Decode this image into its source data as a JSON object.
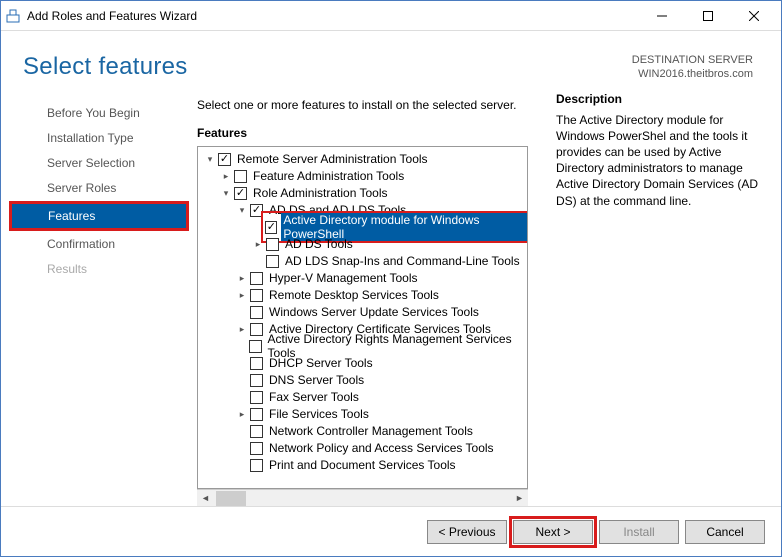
{
  "window": {
    "title": "Add Roles and Features Wizard"
  },
  "header": {
    "title": "Select features",
    "dest_label": "DESTINATION SERVER",
    "dest_server": "WIN2016.theitbros.com"
  },
  "nav": {
    "items": [
      {
        "label": "Before You Begin"
      },
      {
        "label": "Installation Type"
      },
      {
        "label": "Server Selection"
      },
      {
        "label": "Server Roles"
      },
      {
        "label": "Features",
        "active": true
      },
      {
        "label": "Confirmation"
      },
      {
        "label": "Results",
        "disabled": true
      }
    ]
  },
  "content": {
    "instruction": "Select one or more features to install on the selected server.",
    "features_label": "Features",
    "description_label": "Description",
    "description_text": "The Active Directory module for Windows PowerShel and the tools it provides can be used by Active Directory administrators to manage Active Directory Domain Services (AD DS) at the command line."
  },
  "tree": [
    {
      "d": 0,
      "exp": "down",
      "checked": true,
      "label": "Remote Server Administration Tools"
    },
    {
      "d": 1,
      "exp": "right",
      "checked": false,
      "label": "Feature Administration Tools"
    },
    {
      "d": 1,
      "exp": "down",
      "checked": true,
      "label": "Role Administration Tools"
    },
    {
      "d": 2,
      "exp": "down",
      "checked": true,
      "label": "AD DS and AD LDS Tools"
    },
    {
      "d": 3,
      "exp": "",
      "checked": true,
      "label": "Active Directory module for Windows PowerShell",
      "selected": true,
      "highlight": true
    },
    {
      "d": 3,
      "exp": "right",
      "checked": false,
      "label": "AD DS Tools"
    },
    {
      "d": 3,
      "exp": "",
      "checked": false,
      "label": "AD LDS Snap-Ins and Command-Line Tools"
    },
    {
      "d": 2,
      "exp": "right",
      "checked": false,
      "label": "Hyper-V Management Tools"
    },
    {
      "d": 2,
      "exp": "right",
      "checked": false,
      "label": "Remote Desktop Services Tools"
    },
    {
      "d": 2,
      "exp": "",
      "checked": false,
      "label": "Windows Server Update Services Tools"
    },
    {
      "d": 2,
      "exp": "right",
      "checked": false,
      "label": "Active Directory Certificate Services Tools"
    },
    {
      "d": 2,
      "exp": "",
      "checked": false,
      "label": "Active Directory Rights Management Services Tools"
    },
    {
      "d": 2,
      "exp": "",
      "checked": false,
      "label": "DHCP Server Tools"
    },
    {
      "d": 2,
      "exp": "",
      "checked": false,
      "label": "DNS Server Tools"
    },
    {
      "d": 2,
      "exp": "",
      "checked": false,
      "label": "Fax Server Tools"
    },
    {
      "d": 2,
      "exp": "right",
      "checked": false,
      "label": "File Services Tools"
    },
    {
      "d": 2,
      "exp": "",
      "checked": false,
      "label": "Network Controller Management Tools"
    },
    {
      "d": 2,
      "exp": "",
      "checked": false,
      "label": "Network Policy and Access Services Tools"
    },
    {
      "d": 2,
      "exp": "",
      "checked": false,
      "label": "Print and Document Services Tools"
    }
  ],
  "buttons": {
    "previous": "< Previous",
    "next": "Next >",
    "install": "Install",
    "cancel": "Cancel"
  }
}
